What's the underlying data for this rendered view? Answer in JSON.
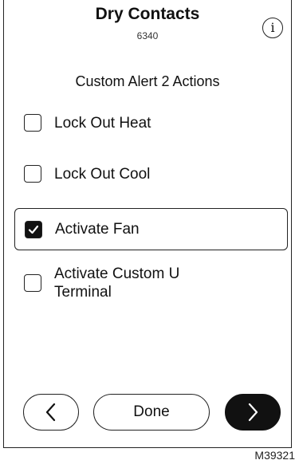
{
  "header": {
    "title": "Dry Contacts",
    "subtitle": "6340",
    "info_icon": "info-icon"
  },
  "section_title": "Custom Alert 2 Actions",
  "options": [
    {
      "label": "Lock Out Heat",
      "checked": false
    },
    {
      "label": "Lock Out Cool",
      "checked": false
    },
    {
      "label": "Activate Fan",
      "checked": true
    },
    {
      "label": "Activate Custom U Terminal",
      "checked": false
    }
  ],
  "footer": {
    "back_icon": "chevron-left-icon",
    "done_label": "Done",
    "next_icon": "chevron-right-icon"
  },
  "figure_id": "M39321"
}
